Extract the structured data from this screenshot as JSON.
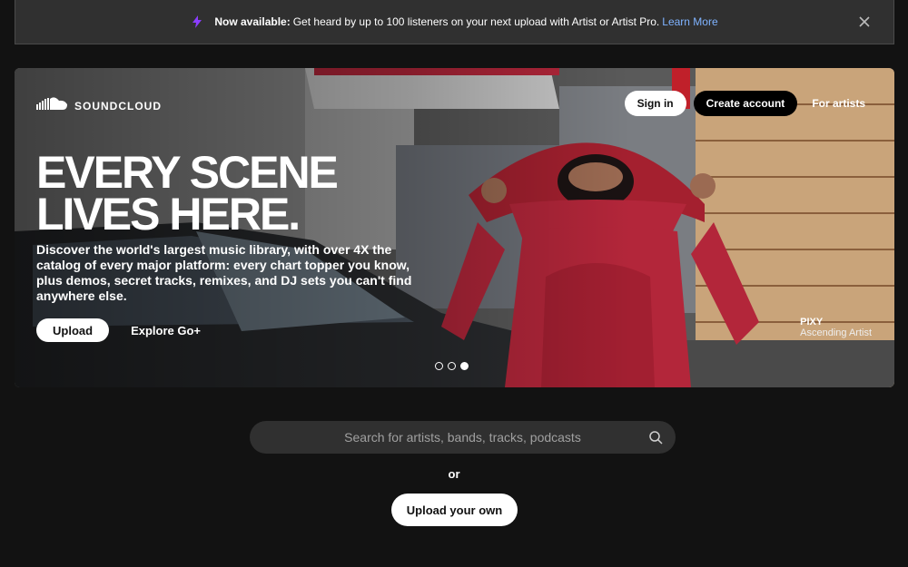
{
  "banner": {
    "strong": "Now available:",
    "text": "Get heard by up to 100 listeners on your next upload with Artist or Artist Pro.",
    "link": "Learn More",
    "accent": "#8b3dff"
  },
  "hero": {
    "logo_text": "SOUNDCLOUD",
    "nav": {
      "sign_in": "Sign in",
      "create_account": "Create account",
      "for_artists": "For artists"
    },
    "headline_line1": "EVERY SCENE",
    "headline_line2": "LIVES HERE.",
    "subtitle": "Discover the world's largest music library, with over 4X the catalog of every major platform: every chart topper you know, plus demos, secret tracks, remixes, and DJ sets you can't find anywhere else.",
    "upload_label": "Upload",
    "explore_label": "Explore Go+",
    "artist_name": "PIXY",
    "artist_role": "Ascending Artist",
    "slides_total": 3,
    "slide_active": 3
  },
  "search": {
    "placeholder": "Search for artists, bands, tracks, podcasts",
    "value": ""
  },
  "or_label": "or",
  "upload_own_label": "Upload your own",
  "colors": {
    "background": "#121212",
    "banner_bg": "#303030",
    "link": "#7fb3ff",
    "shirt": "#b3263a"
  },
  "icons": [
    "lightning-icon",
    "close-icon",
    "soundcloud-logo-icon",
    "search-icon"
  ]
}
